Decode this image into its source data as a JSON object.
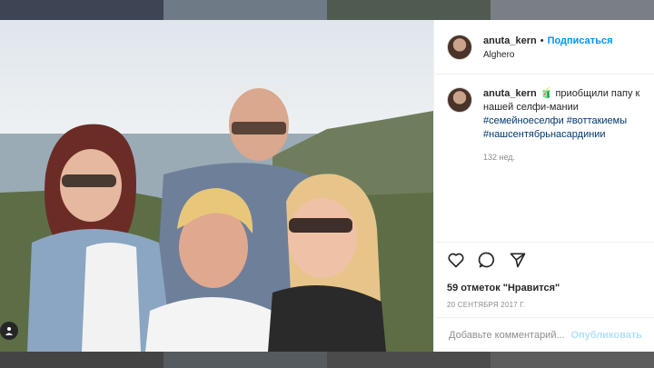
{
  "post": {
    "username": "anuta_kern",
    "separator": "•",
    "follow_label": "Подписаться",
    "location": "Alghero"
  },
  "caption": {
    "username": "anuta_kern",
    "emoji": "🧃",
    "text": "приобщили папу к нашей селфи-мании",
    "hashtags": "#семейноеселфи #воттакиемы #нашсентябрьнасардинии",
    "time": "132 нед."
  },
  "actions": {
    "like_icon": "heart-icon",
    "comment_icon": "comment-icon",
    "share_icon": "share-icon"
  },
  "likes": "59 отметок \"Нравится\"",
  "date": "20 СЕНТЯБРЯ 2017 Г.",
  "comment_box": {
    "placeholder": "Добавьте комментарий...",
    "publish_label": "Опубликовать"
  },
  "colors": {
    "accent": "#0095f6",
    "hashtag": "#00376b",
    "muted": "#8e8e8e"
  }
}
